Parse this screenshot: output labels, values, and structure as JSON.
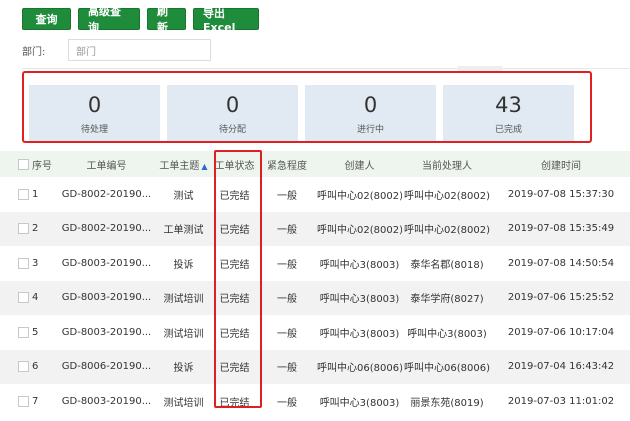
{
  "toolbar": {
    "query": "查询",
    "advanced_query": "高级查询",
    "refresh": "刷新",
    "export_excel": "导出Excel"
  },
  "filter": {
    "department_label": "部门:",
    "department_placeholder": "部门"
  },
  "stats": [
    {
      "value": "0",
      "label": "待处理"
    },
    {
      "value": "0",
      "label": "待分配"
    },
    {
      "value": "0",
      "label": "进行中"
    },
    {
      "value": "43",
      "label": "已完成"
    }
  ],
  "table": {
    "headers": {
      "index": "序号",
      "code": "工单编号",
      "topic": "工单主题",
      "status": "工单状态",
      "urgency": "紧急程度",
      "creator": "创建人",
      "handler": "当前处理人",
      "created_time": "创建时间"
    },
    "rows": [
      {
        "index": "1",
        "code": "GD-8002-20190...",
        "topic": "测试",
        "status": "已完结",
        "urgency": "一般",
        "creator": "呼叫中心02(8002)",
        "handler": "呼叫中心02(8002)",
        "created_time": "2019-07-08 15:37:30"
      },
      {
        "index": "2",
        "code": "GD-8002-20190...",
        "topic": "工单测试",
        "status": "已完结",
        "urgency": "一般",
        "creator": "呼叫中心02(8002)",
        "handler": "呼叫中心02(8002)",
        "created_time": "2019-07-08 15:35:49"
      },
      {
        "index": "3",
        "code": "GD-8003-20190...",
        "topic": "投诉",
        "status": "已完结",
        "urgency": "一般",
        "creator": "呼叫中心3(8003)",
        "handler": "泰华名郡(8018)",
        "created_time": "2019-07-08 14:50:54"
      },
      {
        "index": "4",
        "code": "GD-8003-20190...",
        "topic": "测试培训",
        "status": "已完结",
        "urgency": "一般",
        "creator": "呼叫中心3(8003)",
        "handler": "泰华学府(8027)",
        "created_time": "2019-07-06 15:25:52"
      },
      {
        "index": "5",
        "code": "GD-8003-20190...",
        "topic": "测试培训",
        "status": "已完结",
        "urgency": "一般",
        "creator": "呼叫中心3(8003)",
        "handler": "呼叫中心3(8003)",
        "created_time": "2019-07-06 10:17:04"
      },
      {
        "index": "6",
        "code": "GD-8006-20190...",
        "topic": "投诉",
        "status": "已完结",
        "urgency": "一般",
        "creator": "呼叫中心06(8006)",
        "handler": "呼叫中心06(8006)",
        "created_time": "2019-07-04 16:43:42"
      },
      {
        "index": "7",
        "code": "GD-8003-20190...",
        "topic": "测试培训",
        "status": "已完结",
        "urgency": "一般",
        "creator": "呼叫中心3(8003)",
        "handler": "丽景东苑(8019)",
        "created_time": "2019-07-03 11:01:02"
      }
    ]
  },
  "colors": {
    "button_green": "#1e8c3a",
    "highlight_red": "#e02020",
    "stat_card_bg": "#e1e9f2",
    "header_bg": "#eef5ee"
  },
  "icons": {
    "sort": "sort-caret-icon"
  }
}
